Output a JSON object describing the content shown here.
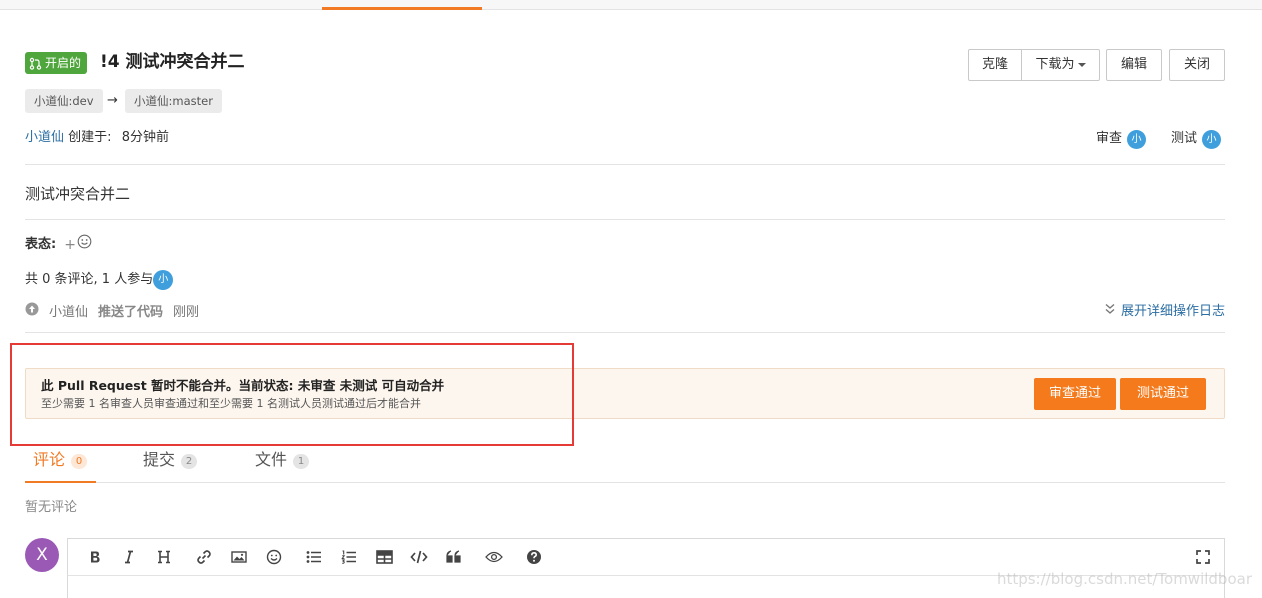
{
  "pr": {
    "status": "开启的",
    "title": "!4 测试冲突合并二",
    "source_branch": "小道仙:dev",
    "arrow": "→",
    "target_branch": "小道仙:master",
    "author": "小道仙",
    "created_label": "创建于:",
    "created_time": "8分钟前",
    "description": "测试冲突合并二"
  },
  "actions": {
    "clone": "克隆",
    "download": "下载为",
    "edit": "编辑",
    "close": "关闭"
  },
  "reviewers": {
    "review_label": "审查",
    "test_label": "测试",
    "avatar_letter": "小"
  },
  "reactions": {
    "label": "表态:",
    "add": "+"
  },
  "participation": {
    "text": "共 0 条评论, 1 人参与",
    "avatar_letter": "小"
  },
  "timeline": {
    "actor": "小道仙",
    "action": "推送了代码",
    "time": "刚刚",
    "expand": "展开详细操作日志"
  },
  "merge_status": {
    "title": "此 Pull Request 暂时不能合并。当前状态: 未审查 未测试 可自动合并",
    "detail": "至少需要 1 名审查人员审查通过和至少需要 1 名测试人员测试通过后才能合并",
    "approve_button": "审查通过",
    "test_button": "测试通过"
  },
  "tabs": [
    {
      "label": "评论",
      "count": "0",
      "active": true
    },
    {
      "label": "提交",
      "count": "2",
      "active": false
    },
    {
      "label": "文件",
      "count": "1",
      "active": false
    }
  ],
  "comments": {
    "empty": "暂无评论"
  },
  "current_user": {
    "avatar_letter": "X"
  },
  "editor": {
    "tools": [
      "bold",
      "italic",
      "heading",
      "link",
      "image",
      "emoji",
      "bullet-list",
      "numbered-list",
      "table",
      "code",
      "quote",
      "preview",
      "help",
      "fullscreen"
    ]
  },
  "watermark": "https://blog.csdn.net/Tomwildboar",
  "colors": {
    "accent": "#f27a24",
    "open_badge": "#4fa63c",
    "link": "#2b6ea3",
    "highlight": "#e53b36",
    "avatar_purple": "#9b59b6",
    "avatar_blue": "#3f9fdc"
  }
}
